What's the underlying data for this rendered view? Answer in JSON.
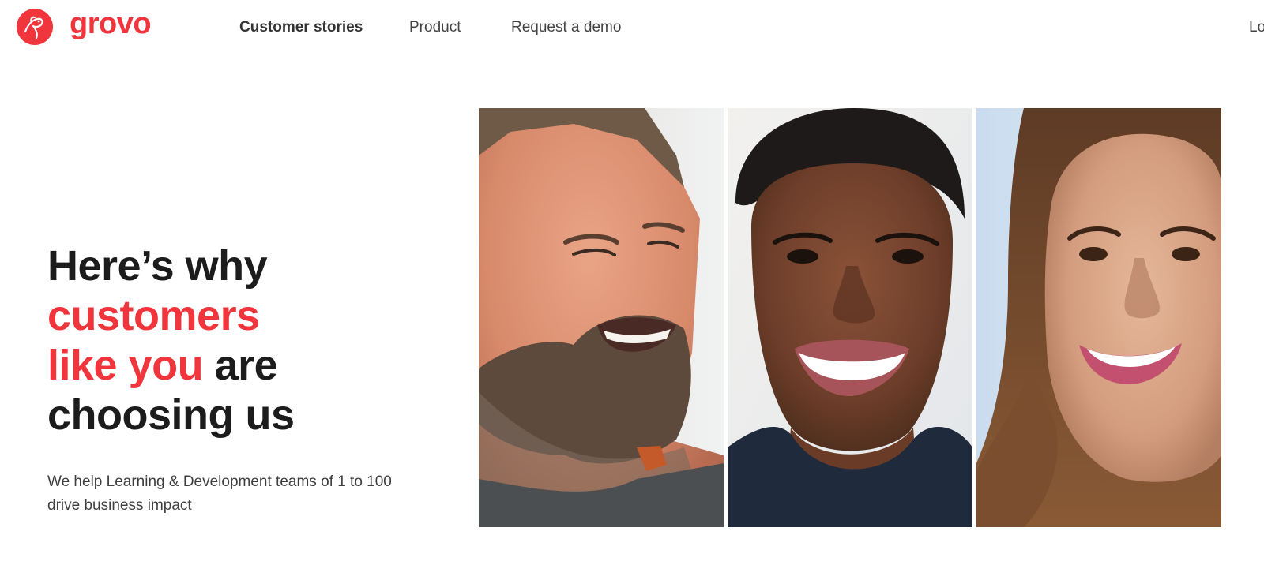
{
  "brand": {
    "name": "grovo",
    "accent_color": "#f0353c",
    "logo_icon": "grovo-bird-logo-icon"
  },
  "nav": {
    "items": [
      {
        "label": "Customer stories",
        "active": true
      },
      {
        "label": "Product",
        "active": false
      },
      {
        "label": "Request a demo",
        "active": false
      }
    ],
    "login_label_visible": "Lo"
  },
  "hero": {
    "title_line1": "Here’s why",
    "title_accent_1": "customers",
    "title_accent_2": "like you",
    "title_rest_2": " are",
    "title_line4": "choosing us",
    "subtitle": "We help Learning & Development teams of 1 to 100 drive business impact"
  },
  "photos": [
    {
      "subject": "smiling-bearded-man-photo"
    },
    {
      "subject": "smiling-woman-short-hair-photo"
    },
    {
      "subject": "smiling-woman-long-hair-photo"
    }
  ]
}
